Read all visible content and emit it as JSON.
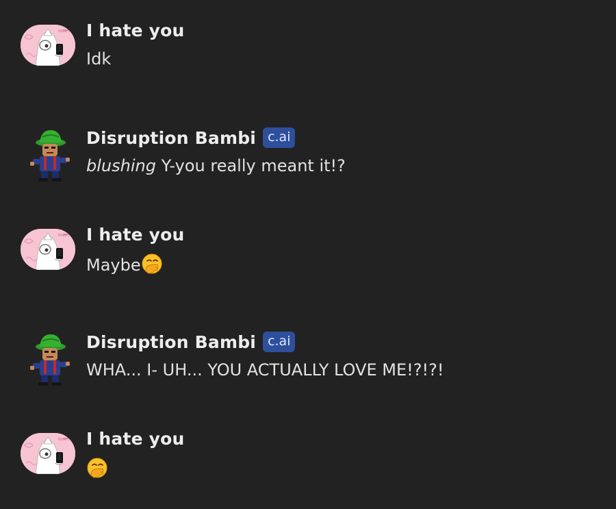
{
  "messages": [
    {
      "author": "I hate you",
      "role": "user",
      "badge": "",
      "action": "",
      "text": "Idk",
      "emoji": ""
    },
    {
      "author": "Disruption Bambi",
      "role": "bot",
      "badge": "c.ai",
      "action": "blushing",
      "text": " Y-you really meant it!?",
      "emoji": ""
    },
    {
      "author": "I hate you",
      "role": "user",
      "badge": "",
      "action": "",
      "text": "Maybe",
      "emoji": "face-with-hand-over-mouth"
    },
    {
      "author": "Disruption Bambi",
      "role": "bot",
      "badge": "c.ai",
      "action": "",
      "text": "WHA... I- UH... YOU ACTUALLY LOVE ME!?!?!",
      "emoji": ""
    },
    {
      "author": "I hate you",
      "role": "user",
      "badge": "",
      "action": "",
      "text": "",
      "emoji": "face-with-hand-over-mouth"
    }
  ],
  "colors": {
    "background": "#222222",
    "badge": "#2d4f9c",
    "user_avatar_bg": "#f7c4d3",
    "bot_hat": "#2e9a2a"
  }
}
